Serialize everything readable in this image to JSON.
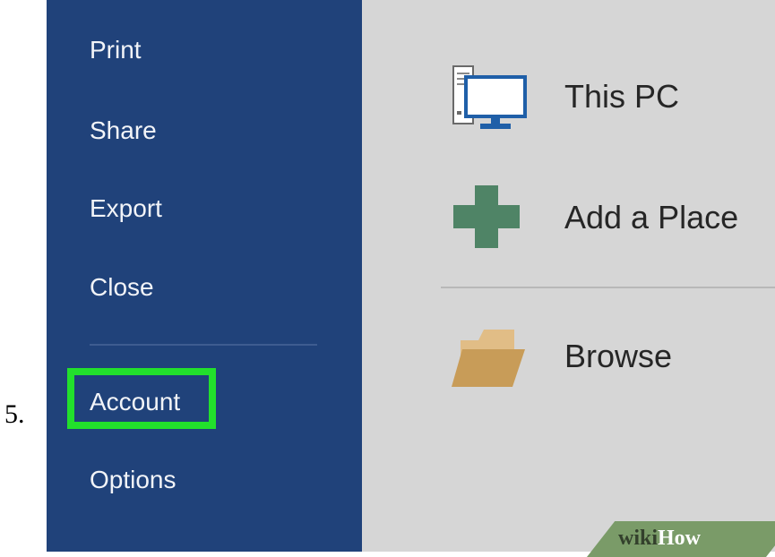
{
  "step_number": "5.",
  "sidebar": {
    "items": [
      {
        "label": "Print"
      },
      {
        "label": "Share"
      },
      {
        "label": "Export"
      },
      {
        "label": "Close"
      },
      {
        "label": "Account",
        "highlighted": true
      },
      {
        "label": "Options"
      }
    ]
  },
  "places": [
    {
      "label": "This PC",
      "icon": "computer-icon"
    },
    {
      "label": "Add a Place",
      "icon": "plus-icon"
    },
    {
      "label": "Browse",
      "icon": "folder-icon"
    }
  ],
  "watermark": {
    "part1": "wiki",
    "part2": "How"
  },
  "colors": {
    "sidebar": "#20427a",
    "main_background": "#d6d6d6",
    "highlight": "#22e02c",
    "plus_icon": "#4f8466",
    "folder_icon": "#c89c58",
    "computer_icon": "#1f5fa8"
  }
}
